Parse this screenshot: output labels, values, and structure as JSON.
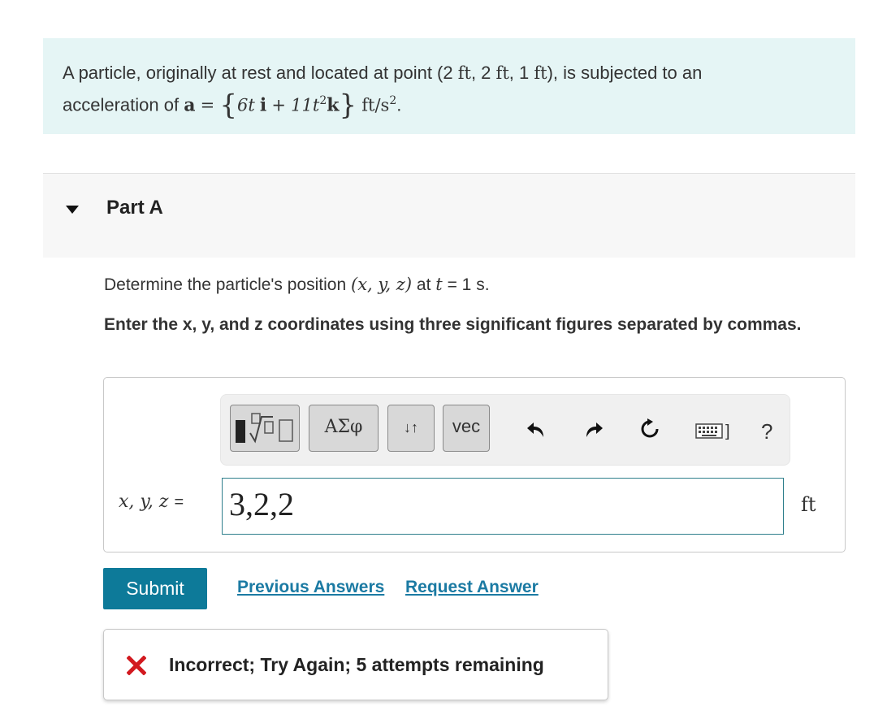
{
  "problem": {
    "text_1": "A particle, originally at rest and located at point (2",
    "ft_1": "ft",
    "sep_1": ", 2",
    "ft_2": "ft",
    "sep_2": ", 1",
    "ft_3": "ft",
    "text_2": "), is subjected to an",
    "text_3": "acceleration of",
    "accel_symbol": "a",
    "equals": "=",
    "term_1": "6t",
    "unit_vec_i": "i",
    "plus": "+",
    "term_2": "11t",
    "term_2_exp": "2",
    "unit_vec_k": "k",
    "accel_unit": "ft/s",
    "accel_unit_exp": "2",
    "period": "."
  },
  "part": {
    "title": "Part A"
  },
  "question": {
    "text_1": "Determine the particle's position",
    "coords": "(x, y, z)",
    "text_2": "at",
    "t_var": "t",
    "text_3": "= 1 s."
  },
  "instruction": "Enter the x, y, and z coordinates using three significant figures separated by commas.",
  "toolbar": {
    "greek_label": "ΑΣφ",
    "arrows_label": "↓↑",
    "vec_label": "vec",
    "keyboard_bracket": "]",
    "help_label": "?"
  },
  "answer": {
    "prefix_vars": "x, y, z",
    "prefix_eq": "=",
    "value": "3,2,2",
    "unit": "ft"
  },
  "actions": {
    "submit_label": "Submit",
    "previous_answers": "Previous Answers",
    "request_answer": "Request Answer"
  },
  "feedback": {
    "message": "Incorrect; Try Again; 5 attempts remaining"
  },
  "colors": {
    "problem_bg": "#e5f5f5",
    "submit_bg": "#0d7a99",
    "link": "#1b7aa3",
    "error_x": "#d2191f",
    "input_border": "#2f7f8c"
  }
}
